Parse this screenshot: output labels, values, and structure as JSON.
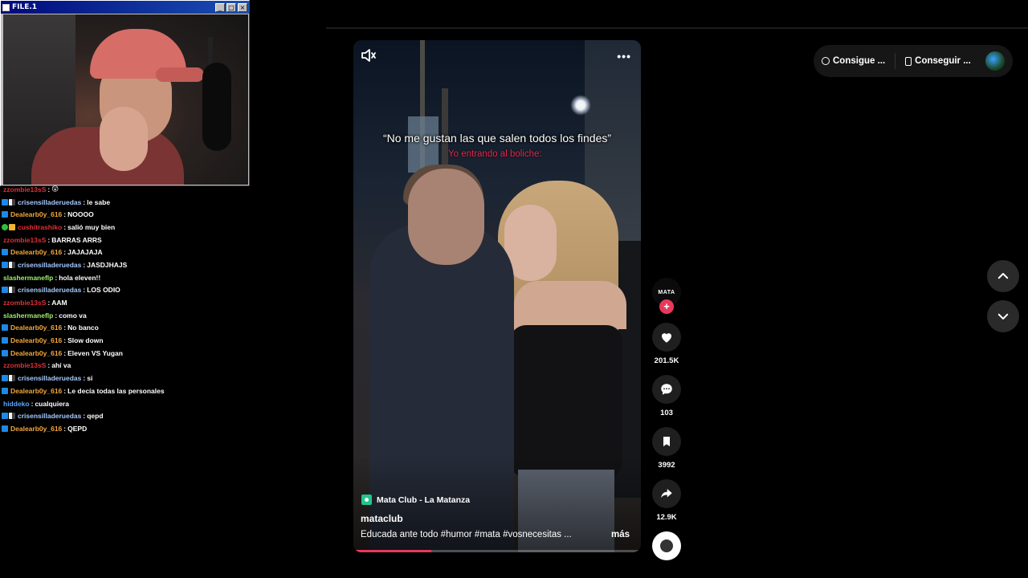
{
  "cam_window": {
    "title": "FILE.1",
    "minimize": "_",
    "maximize": "□",
    "close": "×"
  },
  "chat": [
    {
      "user": "zzombie13sS",
      "msg": "😲",
      "color": "zombie",
      "badges": []
    },
    {
      "user": "crisensilladeruedas",
      "msg": "le sabe",
      "color": "cris",
      "badges": [
        "blue",
        "split"
      ]
    },
    {
      "user": "Dealearb0y_616",
      "msg": "NOOOO",
      "color": "dealer",
      "badges": [
        "blue"
      ]
    },
    {
      "user": "cushitrashiko",
      "msg": "salió muy bien",
      "color": "cush",
      "badges": [
        "green",
        "gold"
      ]
    },
    {
      "user": "zzombie13sS",
      "msg": "BARRAS ARRS",
      "color": "zombie",
      "badges": []
    },
    {
      "user": "Dealearb0y_616",
      "msg": "JAJAJAJA",
      "color": "dealer",
      "badges": [
        "blue"
      ]
    },
    {
      "user": "crisensilladeruedas",
      "msg": "JASDJHAJS",
      "color": "cris",
      "badges": [
        "blue",
        "split"
      ]
    },
    {
      "user": "slashermaneflp",
      "msg": "hola eleven!!",
      "color": "slash",
      "badges": []
    },
    {
      "user": "crisensilladeruedas",
      "msg": "LOS ODIO",
      "color": "cris",
      "badges": [
        "blue",
        "split"
      ]
    },
    {
      "user": "zzombie13sS",
      "msg": "AAM",
      "color": "zombie",
      "badges": []
    },
    {
      "user": "slashermaneflp",
      "msg": "como va",
      "color": "slash",
      "badges": []
    },
    {
      "user": "Dealearb0y_616",
      "msg": "No banco",
      "color": "dealer",
      "badges": [
        "blue"
      ]
    },
    {
      "user": "Dealearb0y_616",
      "msg": "Slow down",
      "color": "dealer",
      "badges": [
        "blue"
      ]
    },
    {
      "user": "Dealearb0y_616",
      "msg": "Eleven VS Yugan",
      "color": "dealer",
      "badges": [
        "blue"
      ]
    },
    {
      "user": "zzombie13sS",
      "msg": "ahí va",
      "color": "zombie",
      "badges": []
    },
    {
      "user": "crisensilladeruedas",
      "msg": "si",
      "color": "cris",
      "badges": [
        "blue",
        "split"
      ]
    },
    {
      "user": "Dealearb0y_616",
      "msg": "Le decía todas las personales",
      "color": "dealer",
      "badges": [
        "blue"
      ]
    },
    {
      "user": "hiddeko",
      "msg": "cualquiera",
      "color": "hidd",
      "badges": []
    },
    {
      "user": "crisensilladeruedas",
      "msg": "qepd",
      "color": "cris",
      "badges": [
        "blue",
        "split"
      ]
    },
    {
      "user": "Dealearb0y_616",
      "msg": "QEPD",
      "color": "dealer",
      "badges": [
        "blue"
      ]
    }
  ],
  "video": {
    "caption_main": "“No me gustan las que salen todos los findes”",
    "caption_red": "Yo entrando al boliche:",
    "location": "Mata Club - La Matanza",
    "author": "mataclub",
    "description": "Educada ante todo #humor  #mata  #vosnecesitas  ...",
    "more_label": "más",
    "more_icon": "more-dots-icon",
    "sound_icon": "volume-icon",
    "progress": 0.27
  },
  "actions": {
    "avatar_label": "MATA",
    "follow_label": "+",
    "likes": "201.5K",
    "comments": "103",
    "saves": "3992",
    "shares": "12.9K"
  },
  "header_pills": {
    "coins_label": "Consigue ...",
    "app_label": "Conseguir ..."
  },
  "colors": {
    "accent": "#e8395a",
    "bg": "#000000"
  }
}
